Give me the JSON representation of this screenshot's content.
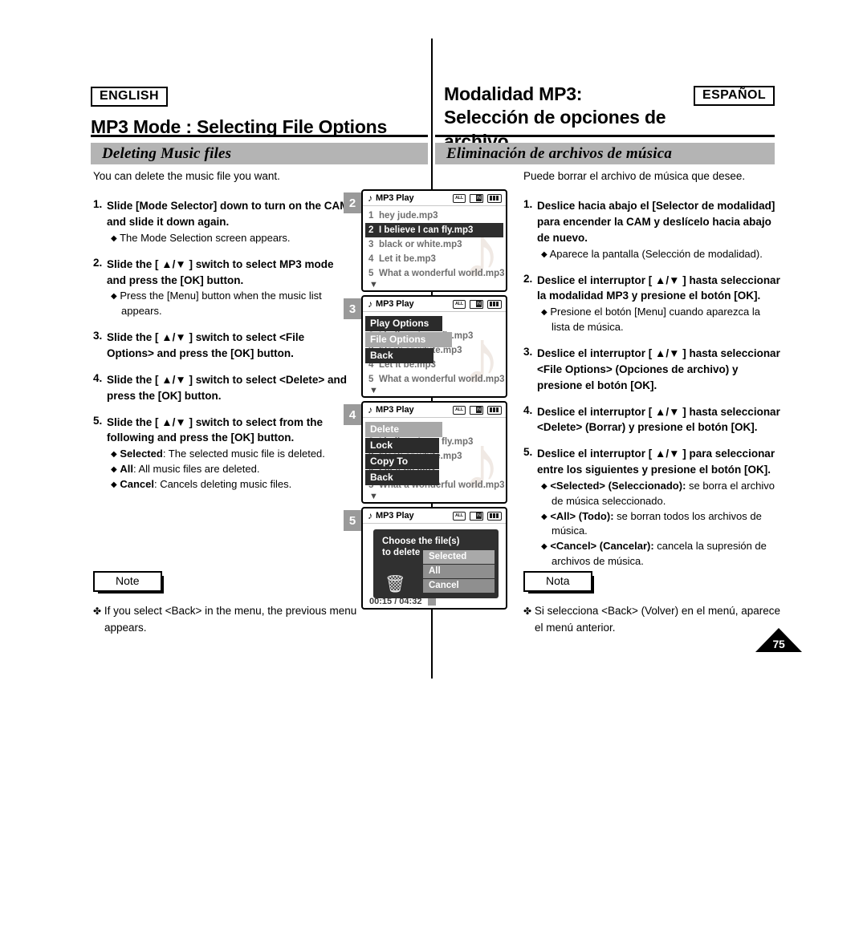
{
  "header": {
    "english_tag": "ENGLISH",
    "english_title": "MP3 Mode : Selecting File Options",
    "spanish_tag": "ESPAÑOL",
    "spanish_title_line1": "Modalidad MP3:",
    "spanish_title_line2": "Selección de opciones de archivo"
  },
  "banner": {
    "english": "Deleting Music files",
    "spanish": "Eliminación de archivos de música"
  },
  "english": {
    "intro": "You can delete the music file you want.",
    "steps": [
      {
        "num": "1.",
        "title": "Slide [Mode Selector] down to turn on the CAM and slide it down again.",
        "bullets": [
          "The Mode Selection screen appears."
        ]
      },
      {
        "num": "2.",
        "title": "Slide the [ ▲/▼ ] switch to select MP3 mode and press the [OK] button.",
        "bullets": [
          "Press the [Menu] button when the music list appears."
        ]
      },
      {
        "num": "3.",
        "title": "Slide the [ ▲/▼ ] switch to select <File Options> and press the [OK] button.",
        "bullets": []
      },
      {
        "num": "4.",
        "title": "Slide the [ ▲/▼ ] switch to select <Delete> and press the [OK] button.",
        "bullets": []
      },
      {
        "num": "5.",
        "title": "Slide the [ ▲/▼ ] switch to select from the following and press the [OK] button.",
        "bullets": [
          "<b>Selected</b>: The selected music file is deleted.",
          "<b>All</b>: All music files are deleted.",
          "<b>Cancel</b>: Cancels deleting music files."
        ]
      }
    ],
    "note_label": "Note",
    "note_text": "If you select <Back> in the menu, the previous menu appears."
  },
  "spanish": {
    "intro": "Puede borrar el archivo de música que desee.",
    "steps": [
      {
        "num": "1.",
        "title": "Deslice hacia abajo el [Selector de modalidad] para encender la CAM y deslícelo hacia abajo de nuevo.",
        "bullets": [
          "Aparece la pantalla <Mode Selection> (Selección de modalidad)."
        ]
      },
      {
        "num": "2.",
        "title": "Deslice el interruptor [ ▲/▼ ] hasta seleccionar la modalidad MP3 y presione el botón [OK].",
        "bullets": [
          "Presione el botón [Menu] cuando aparezca la lista de música."
        ]
      },
      {
        "num": "3.",
        "title": "Deslice el interruptor [ ▲/▼ ] hasta seleccionar <File Options> (Opciones de archivo) y presione el botón [OK].",
        "bullets": []
      },
      {
        "num": "4.",
        "title": "Deslice el interruptor [ ▲/▼ ] hasta seleccionar <Delete> (Borrar) y presione el botón [OK].",
        "bullets": []
      },
      {
        "num": "5.",
        "title": "Deslice el interruptor [ ▲/▼ ] para seleccionar entre los siguientes y presione el botón [OK].",
        "bullets": [
          "<b>&lt;Selected&gt; (Seleccionado):</b> se borra el archivo de música seleccionado.",
          "<b>&lt;All&gt; (Todo):</b> se borran todos los archivos de música.",
          "<b>&lt;Cancel&gt; (Cancelar):</b> cancela la supresión de archivos de música."
        ]
      }
    ],
    "note_label": "Nota",
    "note_text": "Si selecciona <Back> (Volver) en el menú, aparece el menú anterior."
  },
  "lcd": {
    "title": "MP3 Play",
    "status_icons": [
      "all-repeat-icon",
      "memory-card-icon",
      "battery-icon"
    ],
    "all_icon_label": "ALL",
    "card_icon_label": "IN",
    "scroll_arrow": "▼",
    "tracks": [
      {
        "n": "1",
        "name": "hey jude.mp3"
      },
      {
        "n": "2",
        "name": "I believe I can fly.mp3"
      },
      {
        "n": "3",
        "name": "black or white.mp3"
      },
      {
        "n": "4",
        "name": "Let it be.mp3"
      },
      {
        "n": "5",
        "name": "What a wonderful world.mp3"
      }
    ],
    "screens": [
      {
        "badge": "2",
        "selected_track_index": 1
      },
      {
        "badge": "3",
        "menu": [
          "Play Options",
          "File Options",
          "Back"
        ],
        "highlighted": "File Options"
      },
      {
        "badge": "4",
        "menu": [
          "Delete",
          "Lock",
          "Copy To",
          "Back"
        ],
        "highlighted": "Delete"
      },
      {
        "badge": "5",
        "dialog_title_line1": "Choose the file(s)",
        "dialog_title_line2": "to delete",
        "dialog_options": [
          "Selected",
          "All",
          "Cancel"
        ],
        "dialog_highlighted": "Selected",
        "trash_icon": "trash-can-icon",
        "time": "00:15 / 04:32"
      }
    ]
  },
  "page_number": "75"
}
